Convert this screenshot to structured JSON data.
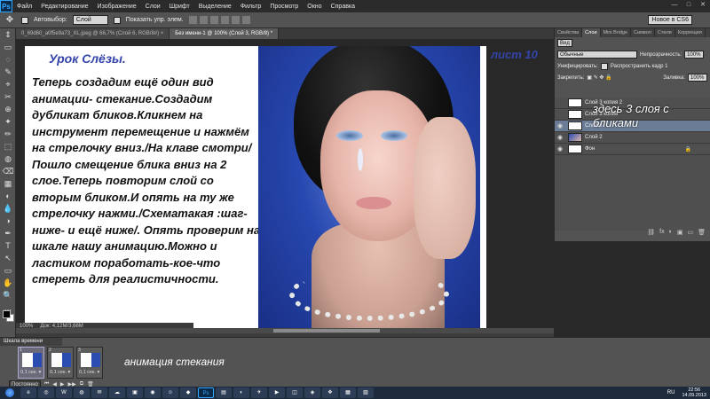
{
  "app": {
    "logo": "Ps"
  },
  "menu": [
    "Файл",
    "Редактирование",
    "Изображение",
    "Слои",
    "Шрифт",
    "Выделение",
    "Фильтр",
    "Просмотр",
    "Окно",
    "Справка"
  ],
  "window_controls": [
    "—",
    "□",
    "✕"
  ],
  "options": {
    "autoselect_label": "Автовыбор:",
    "autoselect_value": "Слой",
    "show_controls_label": "Показать упр. элем.",
    "workspace": "Новое в CS6"
  },
  "doc_tabs": [
    {
      "label": "0_69d60_a0f5e9a73_XL.jpeg @ 66,7% (Слой 6, RGB/8#) ×"
    },
    {
      "label": "Без имени-1 @ 100% (Слой 3, RGB/8) *"
    }
  ],
  "tools": [
    "⇕",
    "▭",
    "◌",
    "✎",
    "⌖",
    "✂",
    "⊕",
    "✦",
    "✏",
    "⬚",
    "◍",
    "⌫",
    "▦",
    "◐",
    "💧",
    "◑",
    "✒",
    "T",
    "↖",
    "▭",
    "✋",
    "🔍",
    "…"
  ],
  "document": {
    "lesson_title": "Урок Слёзы.",
    "sheet_label": "лист 10",
    "body_text": "Теперь создадим ещё один вид анимации- стекание.Создадим дубликат бликов.Кликнем на инструмент перемещение и нажмём на стрелочку вниз./На клаве смотри/Пошло смещение блика вниз на 2 слое.Теперь повторим слой со вторым бликом.И опять на ту же стрелочку нажми./Схематакая :шаг-ниже- и ещё ниже/. Опять проверим на шкале нашу анимацию.Можно и ластиком поработать-кое-что стереть для реалистичности."
  },
  "status": {
    "zoom": "100%",
    "doc_size": "Док: 4,12М/3,66М"
  },
  "panel": {
    "tabs": [
      "Свойства",
      "Слои",
      "Mini Bridge",
      "Символ",
      "Стили",
      "Коррекция"
    ],
    "active_tab": "Слои",
    "filter": "Вид",
    "blend_mode": "Обычные",
    "opacity_label": "Непрозрачность:",
    "opacity_value": "100%",
    "unify_label": "Унифицировать:",
    "propagate_label": "Распространить кадр 1",
    "lock_label": "Закрепить:",
    "fill_label": "Заливка:",
    "fill_value": "100%",
    "footer_icons": [
      "⛓",
      "fx",
      "◐",
      "▣",
      "▭",
      "🗑"
    ]
  },
  "layers": [
    {
      "name": "Слой 3 копия 2",
      "visible": false,
      "thumb": "white",
      "selected": false
    },
    {
      "name": "Слой 3 копия",
      "visible": false,
      "thumb": "white",
      "selected": false
    },
    {
      "name": "Слой 3",
      "visible": true,
      "thumb": "white",
      "selected": true
    },
    {
      "name": "Слой 2",
      "visible": true,
      "thumb": "photo",
      "selected": false
    },
    {
      "name": "Фон",
      "visible": true,
      "thumb": "white",
      "selected": false
    }
  ],
  "overlay_note": "здесь 3 слоя с бликами",
  "timeline": {
    "title": "Шкала времени",
    "frames": [
      {
        "num": "1",
        "delay": "0,1 сек. ▾"
      },
      {
        "num": "2",
        "delay": "0,1 сек. ▾"
      },
      {
        "num": "3",
        "delay": "0,1 сек. ▾"
      }
    ],
    "loop": "Постоянно",
    "controls": [
      "⏮",
      "◀",
      "▶",
      "▶▶",
      "⧉",
      "🗑"
    ],
    "caption": "анимация стекания"
  },
  "taskbar": {
    "apps": [
      "e",
      "◎",
      "W",
      "◍",
      "✉",
      "☁",
      "▣",
      "◉",
      "☺",
      "◆",
      "Ps",
      "▤",
      "◐",
      "✈",
      "▶",
      "◫",
      "◈",
      "❖",
      "▦",
      "▨"
    ],
    "lang": "RU",
    "time": "22:56",
    "date": "14.09.2013"
  },
  "colors": {
    "accent": "#31a8ff",
    "title_blue": "#3344aa"
  }
}
